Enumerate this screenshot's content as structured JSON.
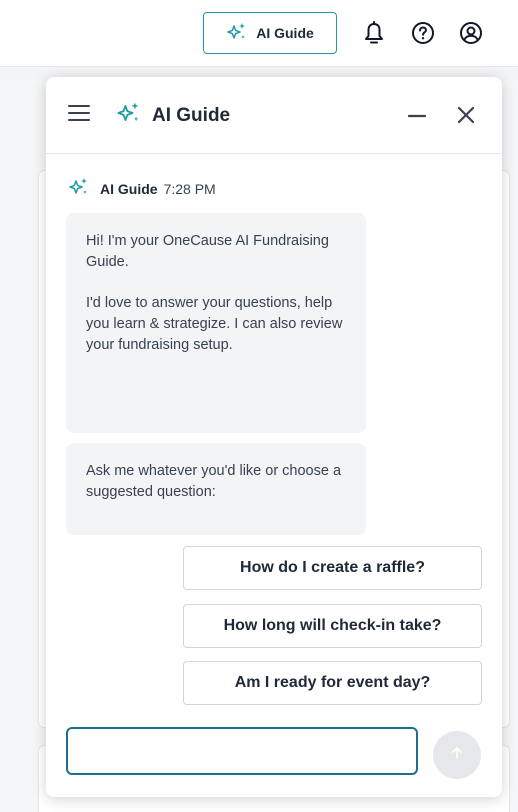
{
  "header": {
    "ai_guide_button_label": "AI Guide",
    "icons": [
      "sparkle-icon",
      "bell-icon",
      "help-icon",
      "user-account-icon"
    ]
  },
  "chat": {
    "title": "AI Guide",
    "message": {
      "author": "AI Guide",
      "time": "7:28 PM",
      "bubble1_line1": "Hi! I'm your OneCause AI Fundraising Guide.",
      "bubble1_line2": "I'd love to answer your questions, help you learn & strategize. I can also review your fundraising setup.",
      "bubble2": "Ask me whatever you'd like or choose a suggested question:"
    },
    "suggestions": [
      "How do I create a raffle?",
      "How long will check-in take?",
      "Am I ready for event day?"
    ],
    "input": {
      "value": "",
      "placeholder": ""
    }
  },
  "colors": {
    "accent_teal": "#1f9ba3",
    "input_border": "#1d6f8f",
    "bubble_bg": "#f3f4f6"
  }
}
